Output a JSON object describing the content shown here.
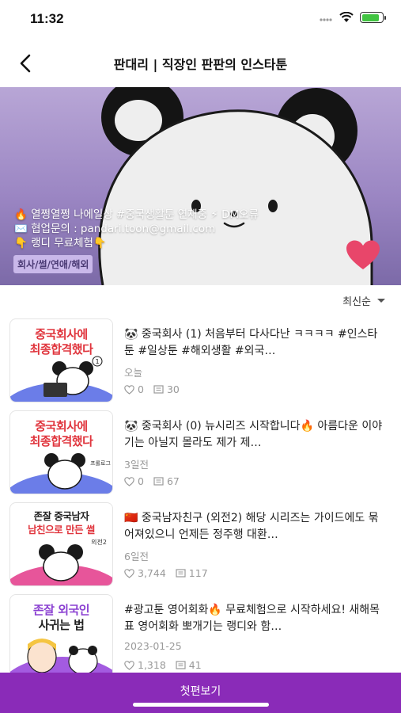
{
  "status": {
    "time": "11:32",
    "battery_level": 0.85
  },
  "nav": {
    "title": "판대리 | 직장인 판판의 인스타툰"
  },
  "hero": {
    "line1": "🔥 열쩡열쩡 나에일상 #중국생활툰 연재중 ⚡ DM오류",
    "line2": "✉️ 협업문의 : pandari.toon@gmail.com",
    "line3": "👇 랭디 무료체험👇",
    "tag": "회사/썰/연애/해외"
  },
  "sort": {
    "label": "최신순"
  },
  "episodes": [
    {
      "thumb_line1": "중국회사에",
      "thumb_line2": "최종합격했다",
      "title": "🐼 중국회사 (1)  처음부터 다사다난 ㅋㅋㅋㅋ  #인스타툰 #일상툰 #해외생활 #외국…",
      "date": "오늘",
      "likes": "0",
      "comments": "30"
    },
    {
      "thumb_line1": "중국회사에",
      "thumb_line2": "최종합격했다",
      "title": "🐼 중국회사 (0)  뉴시리즈 시작합니다🔥 아름다운 이야기는 아닐지 몰라도 제가 제…",
      "date": "3일전",
      "likes": "0",
      "comments": "67"
    },
    {
      "thumb_line1": "존잘 중국남자",
      "thumb_line2": "남친으로 만든 썰",
      "title": "🇨🇳 중국남자친구 (외전2)  해당 시리즈는 가이드에도 묶어져있으니 언제든 정주행 대환…",
      "date": "6일전",
      "likes": "3,744",
      "comments": "117"
    },
    {
      "thumb_line1": "존잘 외국인",
      "thumb_line2": "사귀는 법",
      "title": "#광고툰 영어회화🔥  무료체험으로 시작하세요!  새해목표 영어회화 뽀개기는 랭디와 함…",
      "date": "2023-01-25",
      "likes": "1,318",
      "comments": "41"
    }
  ],
  "bottom": {
    "label": "첫편보기"
  },
  "colors": {
    "accent": "#8a2bb8",
    "hero_bg": "#9b86c3",
    "heart": "#e8466a"
  }
}
